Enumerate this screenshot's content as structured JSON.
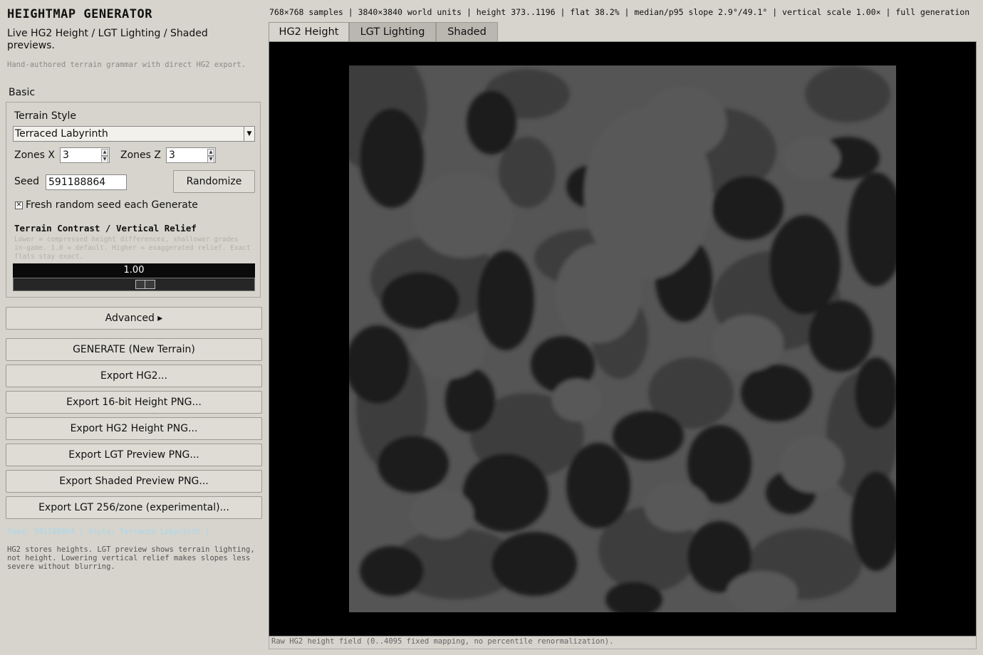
{
  "app": {
    "title": "HEIGHTMAP GENERATOR",
    "subtitle": "Live HG2 Height / LGT Lighting / Shaded previews.",
    "tagline": "Hand-authored terrain grammar with direct HG2 export."
  },
  "basic": {
    "section_label": "Basic",
    "terrain_style_label": "Terrain Style",
    "terrain_style_value": "Terraced Labyrinth",
    "zones_x_label": "Zones X",
    "zones_x_value": "3",
    "zones_z_label": "Zones Z",
    "zones_z_value": "3",
    "seed_label": "Seed",
    "seed_value": "591188864",
    "randomize_label": "Randomize",
    "fresh_seed_label": "Fresh random seed each Generate",
    "fresh_seed_checked": true,
    "relief_title": "Terrain Contrast / Vertical Relief",
    "relief_help": "Lower = compressed height differences, shallower grades in-game. 1.0 = default. Higher = exaggerated relief. Exact flats stay exact.",
    "relief_value": "1.00",
    "relief_position": 0.55
  },
  "actions": {
    "advanced_label": "Advanced ▸",
    "generate_label": "GENERATE  (New Terrain)",
    "export_hg2_label": "Export HG2...",
    "export_16bit_label": "Export 16-bit Height PNG...",
    "export_hg2_png_label": "Export HG2 Height PNG...",
    "export_lgt_png_label": "Export LGT Preview PNG...",
    "export_shaded_label": "Export Shaded Preview PNG...",
    "export_lgt256_label": "Export LGT 256/zone (experimental)..."
  },
  "status_line": "Seed: 591188864   |   Style: Terraced Labyrinth   |",
  "footer_note": "HG2 stores heights. LGT preview shows terrain lighting, not height. Lowering vertical relief makes slopes less severe without blurring.",
  "info_bar": "768×768 samples | 3840×3840 world units | height 373..1196 | flat 38.2% | median/p95 slope 2.9°/49.1° | vertical scale 1.00× | full generation",
  "tabs": [
    {
      "label": "HG2 Height",
      "active": true
    },
    {
      "label": "LGT Lighting",
      "active": false
    },
    {
      "label": "Shaded",
      "active": false
    }
  ],
  "viewport_caption": "Raw HG2 height field (0..4095 fixed mapping, no percentile renormalization).",
  "colors": {
    "panel_bg": "#d6d4cc",
    "viewport_bg": "#000000",
    "terrain_high": "#555555",
    "terrain_mid": "#3c3c3c",
    "terrain_low": "#1d1d1d",
    "status_text": "#a9d7ef"
  }
}
